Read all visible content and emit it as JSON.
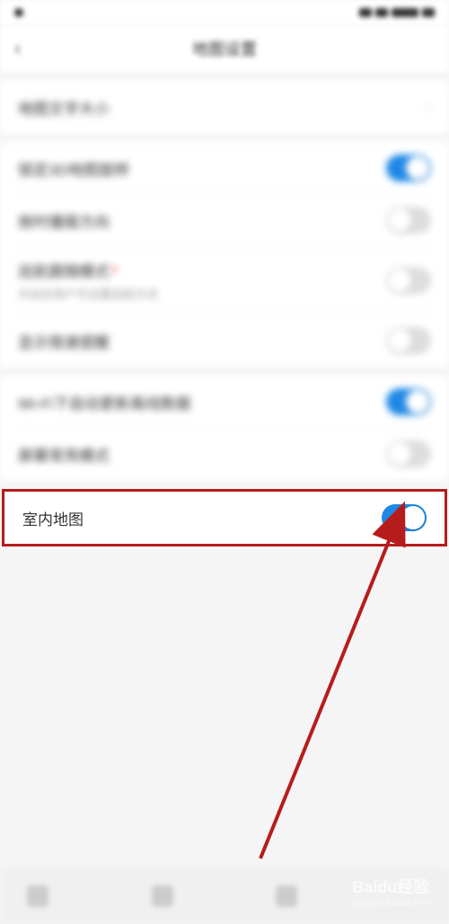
{
  "header": {
    "title": "地图设置"
  },
  "rows": {
    "text_size": {
      "label": "地图文字大小"
    },
    "lock_3d": {
      "label": "锁定3D地图旋转",
      "on": true
    },
    "traffic": {
      "label": "按时播报方向",
      "on": false
    },
    "follow_mode": {
      "label": "巡航跟随模式",
      "sub": "开启后用户可设置巡航方式",
      "on": false
    },
    "show_speed": {
      "label": "显示限速提醒",
      "on": false
    },
    "wifi_update": {
      "label": "Wi-Fi下自动更新离线数据",
      "on": true
    },
    "screen_on": {
      "label": "屏幕常亮模式",
      "on": false
    },
    "indoor_map": {
      "label": "室内地图",
      "on": true
    }
  },
  "watermark": {
    "brand": "Baidu经验",
    "url": "jingyan.baidu.com"
  }
}
